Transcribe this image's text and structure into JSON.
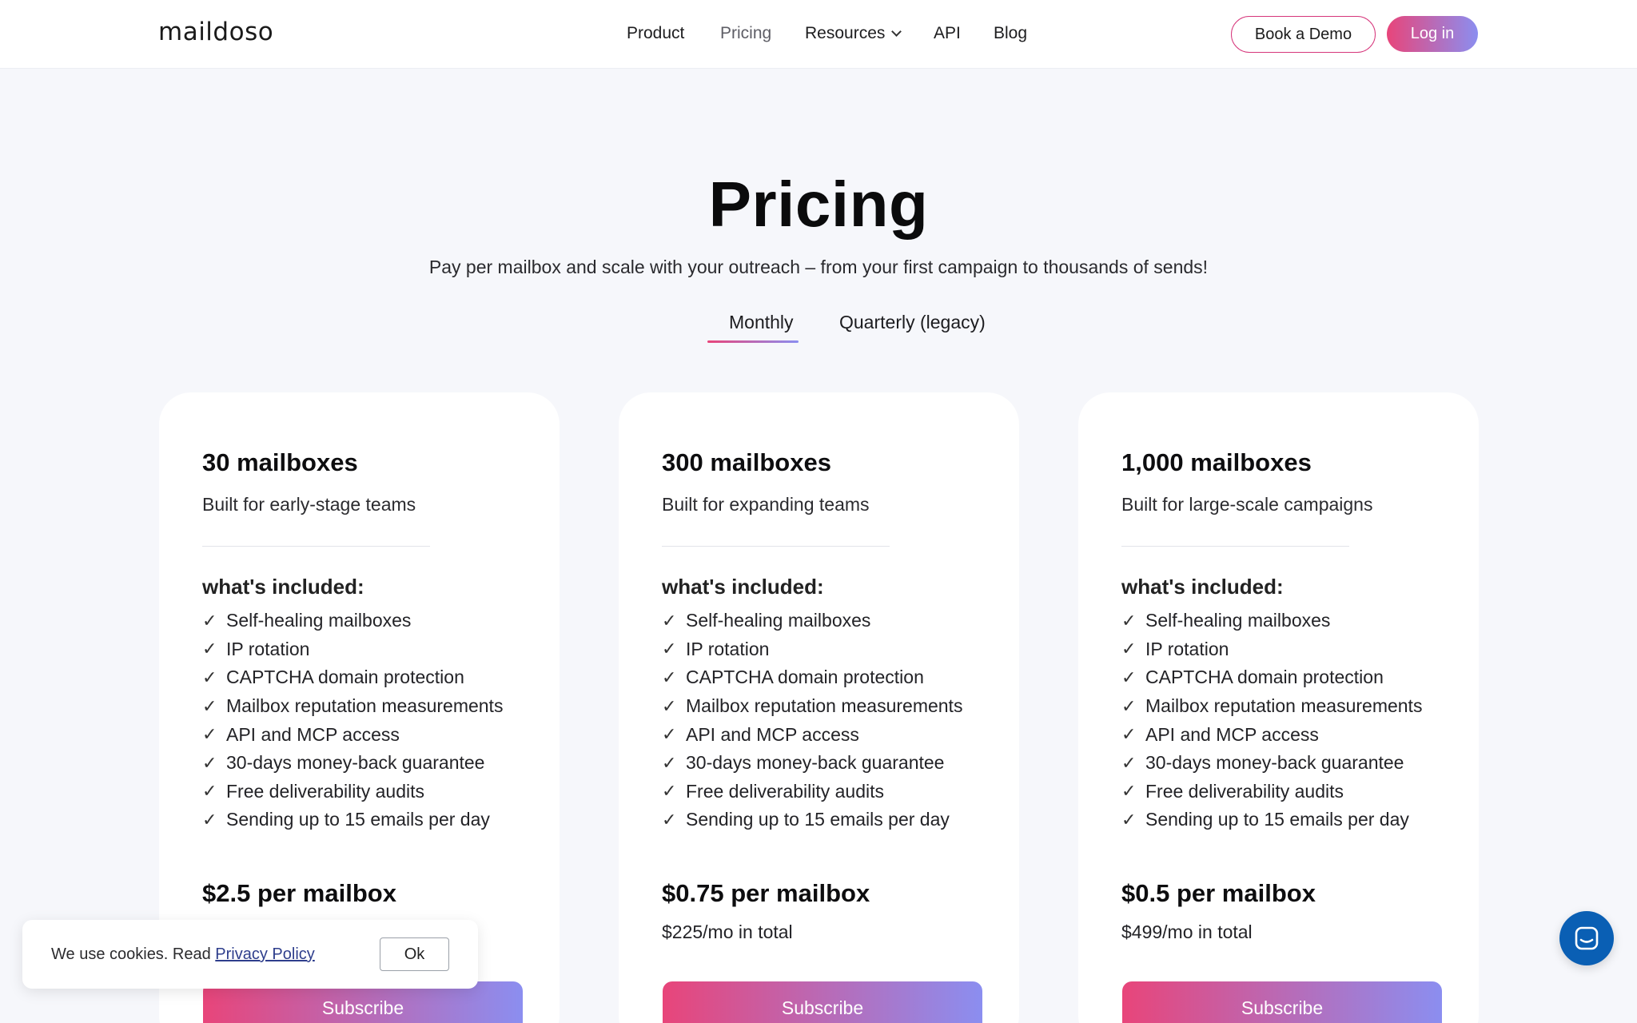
{
  "header": {
    "logo": "maildoso",
    "nav": [
      {
        "label": "Product"
      },
      {
        "label": "Pricing"
      },
      {
        "label": "Resources"
      },
      {
        "label": "API"
      },
      {
        "label": "Blog"
      }
    ],
    "demo_button": "Book a Demo",
    "login_button": "Log in"
  },
  "hero": {
    "title": "Pricing",
    "subtitle": "Pay per mailbox and scale with your outreach – from your first campaign to thousands of sends!"
  },
  "billing_tabs": [
    {
      "label": "Monthly",
      "active": true
    },
    {
      "label": "Quarterly (legacy)",
      "active": false
    }
  ],
  "plans": [
    {
      "title": "30 mailboxes",
      "description": "Built for early-stage teams",
      "included_heading": "what's included:",
      "features": [
        "Self-healing mailboxes",
        "IP rotation",
        "CAPTCHA domain protection",
        "Mailbox reputation measurements",
        "API and MCP access",
        "30-days money-back guarantee",
        "Free deliverability audits",
        "Sending up to 15 emails per day"
      ],
      "price": "$2.5 per mailbox",
      "total": "",
      "cta": "Subscribe"
    },
    {
      "title": "300 mailboxes",
      "description": "Built for expanding teams",
      "included_heading": "what's included:",
      "features": [
        "Self-healing mailboxes",
        "IP rotation",
        "CAPTCHA domain protection",
        "Mailbox reputation measurements",
        "API and MCP access",
        "30-days money-back guarantee",
        "Free deliverability audits",
        "Sending up to 15 emails per day"
      ],
      "price": "$0.75 per mailbox",
      "total": "$225/mo in total",
      "cta": "Subscribe"
    },
    {
      "title": "1,000 mailboxes",
      "description": "Built for large-scale campaigns",
      "included_heading": "what's included:",
      "features": [
        "Self-healing mailboxes",
        "IP rotation",
        "CAPTCHA domain protection",
        "Mailbox reputation measurements",
        "API and MCP access",
        "30-days money-back guarantee",
        "Free deliverability audits",
        "Sending up to 15 emails per day"
      ],
      "price": "$0.5 per mailbox",
      "total": "$499/mo in total",
      "cta": "Subscribe"
    }
  ],
  "cookie_banner": {
    "text": "We use cookies. Read ",
    "link": "Privacy Policy",
    "ok_button": "Ok"
  },
  "chat_widget": {
    "icon": "chat-icon"
  },
  "colors": {
    "accent_start": "#e8457a",
    "accent_end": "#8b8ef0",
    "page_bg": "#f6f7fb",
    "chat_bg": "#0a5fb4"
  }
}
